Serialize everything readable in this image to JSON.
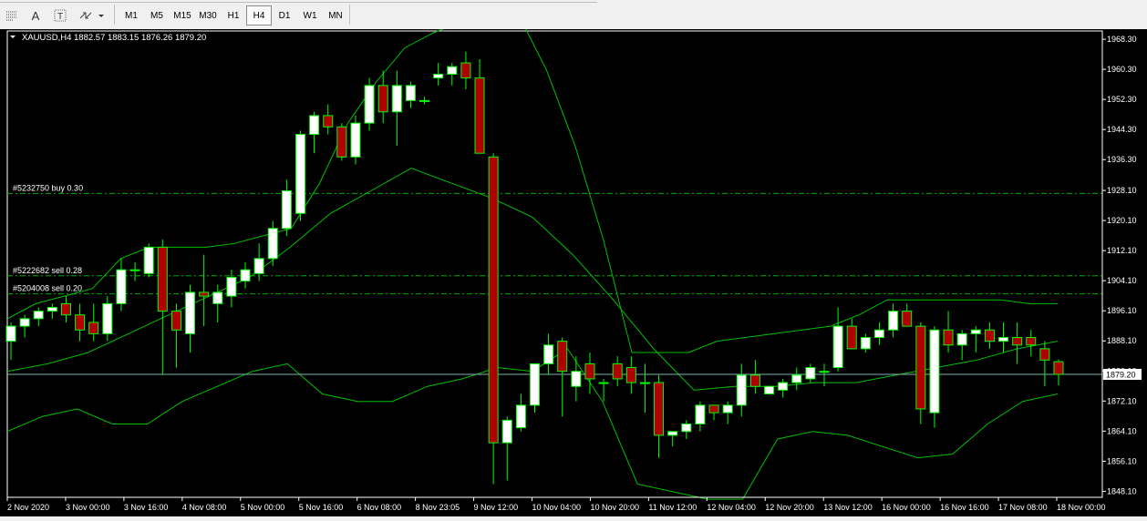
{
  "toolbar": {
    "tools": [
      {
        "name": "crosshair-tool-icon",
        "glyph": "⋮⋮"
      },
      {
        "name": "text-tool-icon",
        "glyph": "A"
      },
      {
        "name": "text-label-tool-icon",
        "glyph": "T"
      },
      {
        "name": "arrows-tool-icon",
        "glyph": "⇆"
      }
    ],
    "timeframes": [
      "M1",
      "M5",
      "M15",
      "M30",
      "H1",
      "H4",
      "D1",
      "W1",
      "MN"
    ],
    "active_timeframe": "H4"
  },
  "chart": {
    "header": "XAUUSD,H4  1882.57 1883.15 1876.26 1879.20",
    "current_price_label": "1879.20",
    "order_lines": [
      {
        "label": "#5232750 buy 0.30",
        "price": 1927.3
      },
      {
        "label": "#5222682 sell 0.28",
        "price": 1905.4
      },
      {
        "label": "#5204008 sell 0.20",
        "price": 1900.6
      }
    ],
    "colors": {
      "background": "#000000",
      "bull": "#ffffff",
      "bear": "#b00000",
      "wick": "#00ff00",
      "indicator": "#00c000",
      "price_line": "#7fb0b0"
    }
  },
  "chart_data": {
    "type": "candlestick",
    "symbol": "XAUUSD",
    "timeframe": "H4",
    "last_ohlc": {
      "open": 1882.57,
      "high": 1883.15,
      "low": 1876.26,
      "close": 1879.2
    },
    "ylim": [
      1846.5,
      1970.5
    ],
    "y_ticks": [
      1968.3,
      1960.3,
      1952.3,
      1944.3,
      1936.3,
      1928.1,
      1920.1,
      1912.1,
      1904.1,
      1896.1,
      1888.1,
      1880.1,
      1872.1,
      1864.1,
      1856.1,
      1848.1
    ],
    "x_labels": [
      "2 Nov 2020",
      "3 Nov 00:00",
      "3 Nov 16:00",
      "4 Nov 08:00",
      "5 Nov 00:00",
      "5 Nov 16:00",
      "6 Nov 08:00",
      "8 Nov 23:05",
      "9 Nov 12:00",
      "10 Nov 04:00",
      "10 Nov 20:00",
      "11 Nov 12:00",
      "12 Nov 04:00",
      "12 Nov 20:00",
      "13 Nov 12:00",
      "16 Nov 00:00",
      "16 Nov 16:00",
      "17 Nov 08:00",
      "18 Nov 00:00"
    ],
    "candles": [
      [
        1888,
        1893,
        1883,
        1892
      ],
      [
        1892,
        1895,
        1889,
        1894
      ],
      [
        1894,
        1897,
        1892,
        1896
      ],
      [
        1896,
        1898,
        1894,
        1897
      ],
      [
        1898,
        1900,
        1893,
        1895
      ],
      [
        1895,
        1898,
        1888,
        1891
      ],
      [
        1893,
        1898,
        1888,
        1890
      ],
      [
        1890,
        1900,
        1888,
        1898
      ],
      [
        1898,
        1910,
        1896,
        1907
      ],
      [
        1907,
        1909,
        1904,
        1907
      ],
      [
        1906,
        1914,
        1905,
        1913
      ],
      [
        1913,
        1915,
        1879,
        1896
      ],
      [
        1896,
        1898,
        1881,
        1891
      ],
      [
        1890,
        1903,
        1885,
        1901
      ],
      [
        1901,
        1911,
        1892,
        1900
      ],
      [
        1898,
        1903,
        1893,
        1901
      ],
      [
        1900,
        1907,
        1897,
        1905
      ],
      [
        1904,
        1909,
        1902,
        1907
      ],
      [
        1906,
        1914,
        1904,
        1910
      ],
      [
        1910,
        1920,
        1908,
        1918
      ],
      [
        1918,
        1931,
        1916,
        1928
      ],
      [
        1922,
        1944,
        1920,
        1943
      ],
      [
        1943,
        1949,
        1938,
        1948
      ],
      [
        1948,
        1951,
        1943,
        1945
      ],
      [
        1945,
        1946,
        1936,
        1937
      ],
      [
        1937,
        1948,
        1935,
        1946
      ],
      [
        1946,
        1958,
        1944,
        1956
      ],
      [
        1956,
        1960,
        1946,
        1949
      ],
      [
        1949,
        1960,
        1940,
        1956
      ],
      [
        1952,
        1957,
        1950,
        1956
      ],
      [
        1952,
        1953,
        1951,
        1952
      ],
      [
        1958,
        1962,
        1956,
        1959
      ],
      [
        1959,
        1962,
        1956,
        1961
      ],
      [
        1962,
        1965,
        1955,
        1958
      ],
      [
        1958,
        1963,
        1938,
        1938
      ],
      [
        1937,
        1938,
        1850,
        1861
      ],
      [
        1861,
        1868,
        1851,
        1867
      ],
      [
        1865,
        1874,
        1864,
        1871
      ],
      [
        1871,
        1882,
        1869,
        1882
      ],
      [
        1882,
        1890,
        1879,
        1887
      ],
      [
        1888,
        1889,
        1868,
        1880
      ],
      [
        1876,
        1884,
        1872,
        1880
      ],
      [
        1882,
        1885,
        1874,
        1878
      ],
      [
        1877,
        1878,
        1872,
        1877
      ],
      [
        1882,
        1884,
        1876,
        1878
      ],
      [
        1881,
        1884,
        1874,
        1877
      ],
      [
        1877,
        1882,
        1869,
        1877
      ],
      [
        1877,
        1879,
        1857,
        1863
      ],
      [
        1863,
        1864,
        1860,
        1864
      ],
      [
        1864,
        1867,
        1862,
        1866
      ],
      [
        1866,
        1872,
        1864,
        1871
      ],
      [
        1871,
        1871,
        1867,
        1869
      ],
      [
        1869,
        1872,
        1866,
        1871
      ],
      [
        1871,
        1882,
        1868,
        1879
      ],
      [
        1879,
        1883,
        1874,
        1876
      ],
      [
        1874,
        1876,
        1874,
        1876
      ],
      [
        1875,
        1878,
        1873,
        1877
      ],
      [
        1877,
        1881,
        1875,
        1879
      ],
      [
        1878,
        1882,
        1877,
        1881
      ],
      [
        1880,
        1882,
        1876,
        1880
      ],
      [
        1881,
        1897,
        1880,
        1892
      ],
      [
        1892,
        1894,
        1886,
        1886
      ],
      [
        1886,
        1890,
        1885,
        1889
      ],
      [
        1889,
        1893,
        1887,
        1891
      ],
      [
        1891,
        1898,
        1889,
        1896
      ],
      [
        1896,
        1898,
        1892,
        1892
      ],
      [
        1892,
        1893,
        1866,
        1870
      ],
      [
        1869,
        1892,
        1865,
        1891
      ],
      [
        1891,
        1896,
        1885,
        1887
      ],
      [
        1887,
        1891,
        1883,
        1890
      ],
      [
        1890,
        1892,
        1885,
        1891
      ],
      [
        1891,
        1893,
        1886,
        1888
      ],
      [
        1888,
        1893,
        1885,
        1889
      ],
      [
        1889,
        1893,
        1882,
        1887
      ],
      [
        1889,
        1891,
        1884,
        1887
      ],
      [
        1886,
        1888,
        1876,
        1883
      ],
      [
        1882.57,
        1883.15,
        1876.26,
        1879.2
      ]
    ],
    "bollinger": {
      "upper": [
        1894,
        1898,
        1900,
        1902,
        1910,
        1913,
        1913,
        1913,
        1914,
        1916,
        1918,
        1930,
        1946,
        1957,
        1966,
        1970,
        1973,
        1978,
        1975,
        1960,
        1940,
        1915,
        1885,
        1885,
        1885,
        1888,
        1889,
        1890,
        1891,
        1892,
        1895,
        1899,
        1899,
        1899,
        1899,
        1899,
        1898,
        1898
      ],
      "middle": [
        1880,
        1882,
        1885,
        1890,
        1895,
        1900,
        1905,
        1913,
        1922,
        1928,
        1934,
        1930,
        1926,
        1921,
        1911,
        1899,
        1886,
        1875,
        1876,
        1876,
        1877,
        1877,
        1879,
        1881,
        1883,
        1886,
        1888
      ],
      "lower": [
        1864,
        1868,
        1870,
        1866,
        1866,
        1872,
        1876,
        1880,
        1882,
        1874,
        1872,
        1872,
        1876,
        1878,
        1881,
        1880,
        1886,
        1872,
        1850,
        1848,
        1846,
        1846,
        1862,
        1864,
        1863,
        1860,
        1857,
        1858,
        1866,
        1872,
        1874
      ]
    }
  }
}
